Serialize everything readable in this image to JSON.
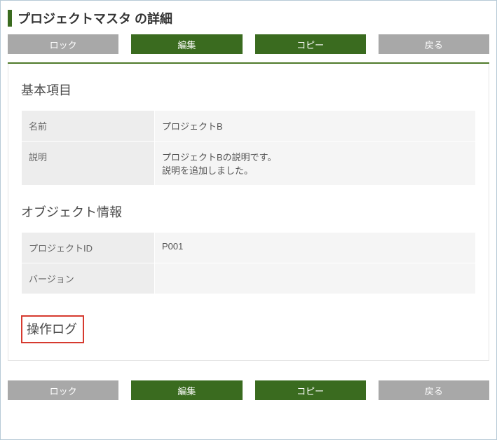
{
  "header": {
    "title": "プロジェクトマスタ の詳細"
  },
  "buttons": {
    "lock": "ロック",
    "edit": "編集",
    "copy": "コピー",
    "back": "戻る"
  },
  "sections": {
    "basic": {
      "heading": "基本項目",
      "rows": {
        "name_label": "名前",
        "name_value": "プロジェクトB",
        "desc_label": "説明",
        "desc_value": "プロジェクトBの説明です。\n説明を追加しました。"
      }
    },
    "object_info": {
      "heading": "オブジェクト情報",
      "rows": {
        "project_id_label": "プロジェクトID",
        "project_id_value": "P001",
        "version_label": "バージョン",
        "version_value": ""
      }
    },
    "operation_log": {
      "heading": "操作ログ"
    }
  }
}
